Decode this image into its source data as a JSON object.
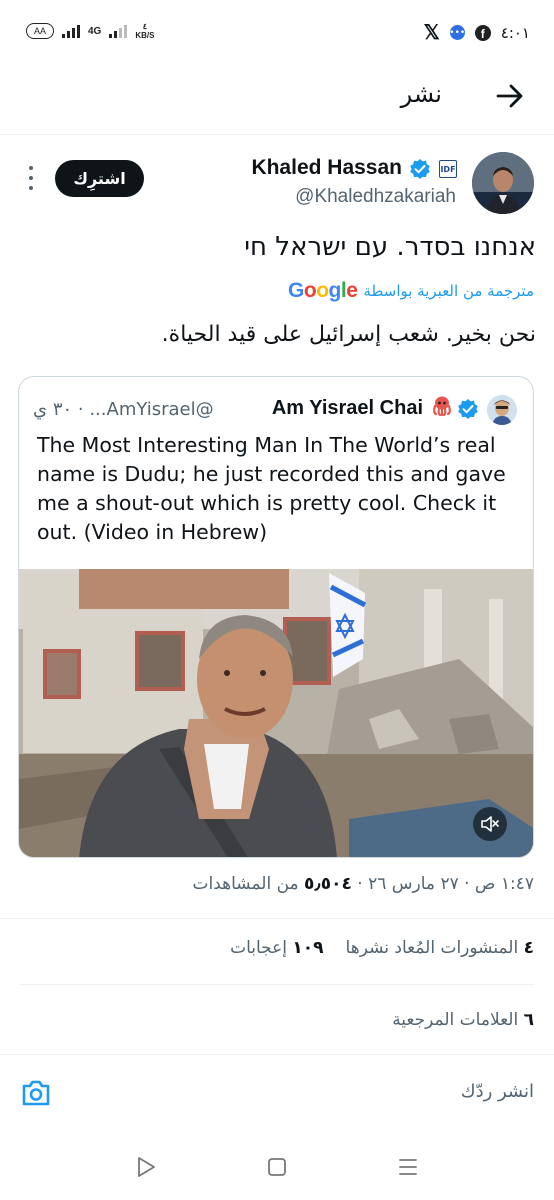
{
  "status_bar": {
    "pill_label": "AA",
    "network": "4G",
    "speed_top": "٤",
    "speed_unit": "KB/S",
    "time": "٤:٠١"
  },
  "header": {
    "title": "نشر"
  },
  "tweet": {
    "author_name": "Khaled Hassan",
    "author_handle": "@Khaledhzakariah",
    "subscribe_label": "اشترِك",
    "text_hebrew": "אנחנו בסדר. עם ישראל חי",
    "translated_label": "مترجمة من العبرية بواسطة",
    "translator": "Google",
    "text_arabic": "نحن بخير. شعب إسرائيل على قيد الحياة."
  },
  "quote": {
    "author_name": "Am Yisrael Chai",
    "handle_time": "@AmYisrael... · ٣٠ ي",
    "text": "The Most Interesting Man In The World’s real name is Dudu; he just recorded this and gave me a shout-out which is pretty cool. Check it out. (Video in Hebrew)"
  },
  "meta": {
    "time_date": "١:٤٧ ص · ٢٧ مارس ٢٦ · ",
    "views_count": "٥٫٥٠٤",
    "views_label": " من المشاهدات"
  },
  "stats": {
    "reposts_count": "٤",
    "reposts_label": " المنشورات المُعاد نشرها",
    "likes_count": "١٠٩",
    "likes_label": " إعجابات",
    "bookmarks_count": "٦",
    "bookmarks_label": " العلامات المرجعية"
  },
  "reply": {
    "placeholder": "انشر ردّك"
  },
  "colors": {
    "accent": "#1d9bf0",
    "text": "#0f1419",
    "muted": "#536471"
  },
  "icons": [
    "back-arrow-icon",
    "verified-icon",
    "more-icon",
    "camera-icon",
    "mute-icon",
    "x-logo-icon",
    "messenger-icon",
    "facebook-icon"
  ]
}
